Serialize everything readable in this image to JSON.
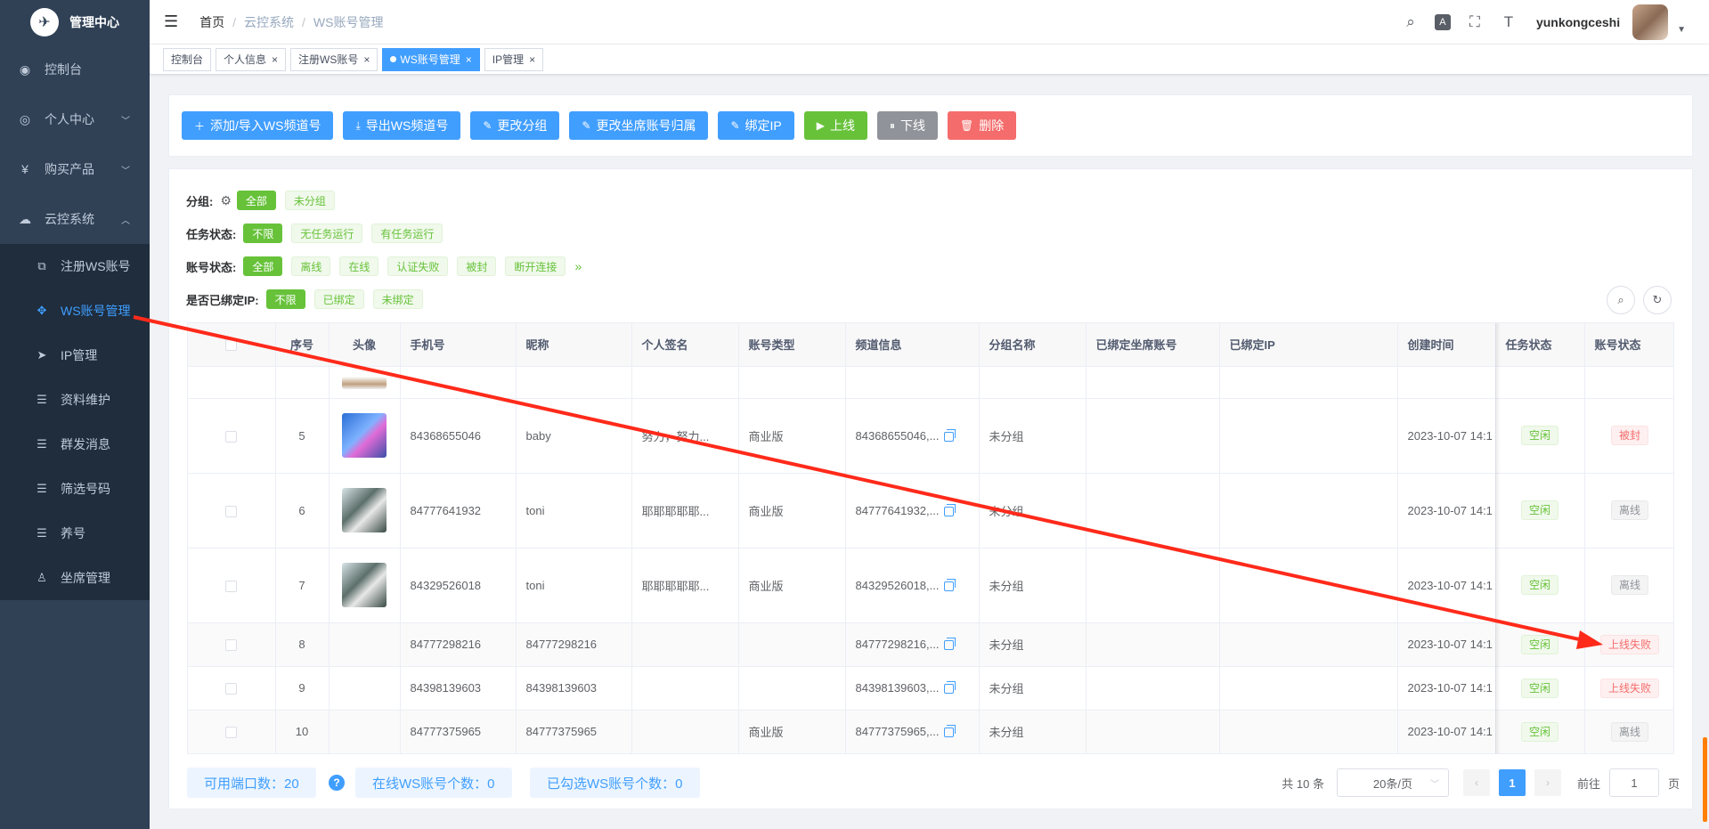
{
  "brand": {
    "title": "管理中心",
    "logo_icon": "bird-logo-icon"
  },
  "sidebar": {
    "items": [
      {
        "label": "控制台",
        "icon": "dashboard-icon"
      },
      {
        "label": "个人中心",
        "icon": "user-circle-icon"
      },
      {
        "label": "购买产品",
        "icon": "yen-icon"
      },
      {
        "label": "云控系统",
        "icon": "cloud-icon"
      }
    ],
    "subitems": [
      {
        "label": "注册WS账号",
        "icon": "external-link-icon"
      },
      {
        "label": "WS账号管理",
        "icon": "move-icon"
      },
      {
        "label": "IP管理",
        "icon": "send-icon"
      },
      {
        "label": "资料维护",
        "icon": "list-icon"
      },
      {
        "label": "群发消息",
        "icon": "list-icon"
      },
      {
        "label": "筛选号码",
        "icon": "list-icon"
      },
      {
        "label": "养号",
        "icon": "list-icon"
      },
      {
        "label": "坐席管理",
        "icon": "user-icon"
      }
    ]
  },
  "header": {
    "breadcrumb": [
      "首页",
      "云控系统",
      "WS账号管理"
    ],
    "username": "yunkongceshi"
  },
  "tags": [
    {
      "label": "控制台"
    },
    {
      "label": "个人信息"
    },
    {
      "label": "注册WS账号"
    },
    {
      "label": "WS账号管理"
    },
    {
      "label": "IP管理"
    }
  ],
  "toolbar": {
    "add": "添加/导入WS频道号",
    "export": "导出WS频道号",
    "group": "更改分组",
    "seat": "更改坐席账号归属",
    "bind_ip": "绑定IP",
    "online": "上线",
    "offline": "下线",
    "delete": "删除"
  },
  "filters": {
    "group": {
      "label": "分组:",
      "options": [
        "全部",
        "未分组"
      ]
    },
    "task": {
      "label": "任务状态:",
      "options": [
        "不限",
        "无任务运行",
        "有任务运行"
      ]
    },
    "account": {
      "label": "账号状态:",
      "options": [
        "全部",
        "离线",
        "在线",
        "认证失败",
        "被封",
        "断开连接"
      ]
    },
    "ip": {
      "label": "是否已绑定IP:",
      "options": [
        "不限",
        "已绑定",
        "未绑定"
      ]
    }
  },
  "table": {
    "headers": [
      "序号",
      "头像",
      "手机号",
      "昵称",
      "个人签名",
      "账号类型",
      "频道信息",
      "分组名称",
      "已绑定坐席账号",
      "已绑定IP",
      "创建时间",
      "任务状态",
      "账号状态"
    ],
    "rows": [
      {
        "no": "5",
        "avatar": "a",
        "phone": "84368655046",
        "nick": "baby",
        "sig": "努力，努力...",
        "type": "商业版",
        "channel": "84368655046,...",
        "group": "未分组",
        "seat": "",
        "ip": "",
        "created": "2023-10-07 14:1",
        "task": "空闲",
        "status": "被封",
        "status_kind": "ban"
      },
      {
        "no": "6",
        "avatar": "b",
        "phone": "84777641932",
        "nick": "toni",
        "sig": "耶耶耶耶耶...",
        "type": "商业版",
        "channel": "84777641932,...",
        "group": "未分组",
        "seat": "",
        "ip": "",
        "created": "2023-10-07 14:1",
        "task": "空闲",
        "status": "离线",
        "status_kind": "off"
      },
      {
        "no": "7",
        "avatar": "b",
        "phone": "84329526018",
        "nick": "toni",
        "sig": "耶耶耶耶耶...",
        "type": "商业版",
        "channel": "84329526018,...",
        "group": "未分组",
        "seat": "",
        "ip": "",
        "created": "2023-10-07 14:1",
        "task": "空闲",
        "status": "离线",
        "status_kind": "off"
      },
      {
        "no": "8",
        "avatar": "",
        "phone": "84777298216",
        "nick": "84777298216",
        "sig": "",
        "type": "",
        "channel": "84777298216,...",
        "group": "未分组",
        "seat": "",
        "ip": "",
        "created": "2023-10-07 14:1",
        "task": "空闲",
        "status": "上线失败",
        "status_kind": "ban"
      },
      {
        "no": "9",
        "avatar": "",
        "phone": "84398139603",
        "nick": "84398139603",
        "sig": "",
        "type": "",
        "channel": "84398139603,...",
        "group": "未分组",
        "seat": "",
        "ip": "",
        "created": "2023-10-07 14:1",
        "task": "空闲",
        "status": "上线失败",
        "status_kind": "ban"
      },
      {
        "no": "10",
        "avatar": "",
        "phone": "84777375965",
        "nick": "84777375965",
        "sig": "",
        "type": "商业版",
        "channel": "84777375965,...",
        "group": "未分组",
        "seat": "",
        "ip": "",
        "created": "2023-10-07 14:1",
        "task": "空闲",
        "status": "离线",
        "status_kind": "off"
      }
    ]
  },
  "footer": {
    "ports": "可用端口数：20",
    "online": "在线WS账号个数：0",
    "selected": "已勾选WS账号个数：0",
    "total": "共 10 条",
    "page_size": "20条/页",
    "current_page": "1",
    "goto_label": "前往",
    "goto_value": "1",
    "page_suffix": "页"
  },
  "colors": {
    "primary": "#409eff",
    "success": "#67c23a",
    "danger": "#f56c6c",
    "sidebar": "#304156",
    "arrow": "#ff2a1a"
  }
}
